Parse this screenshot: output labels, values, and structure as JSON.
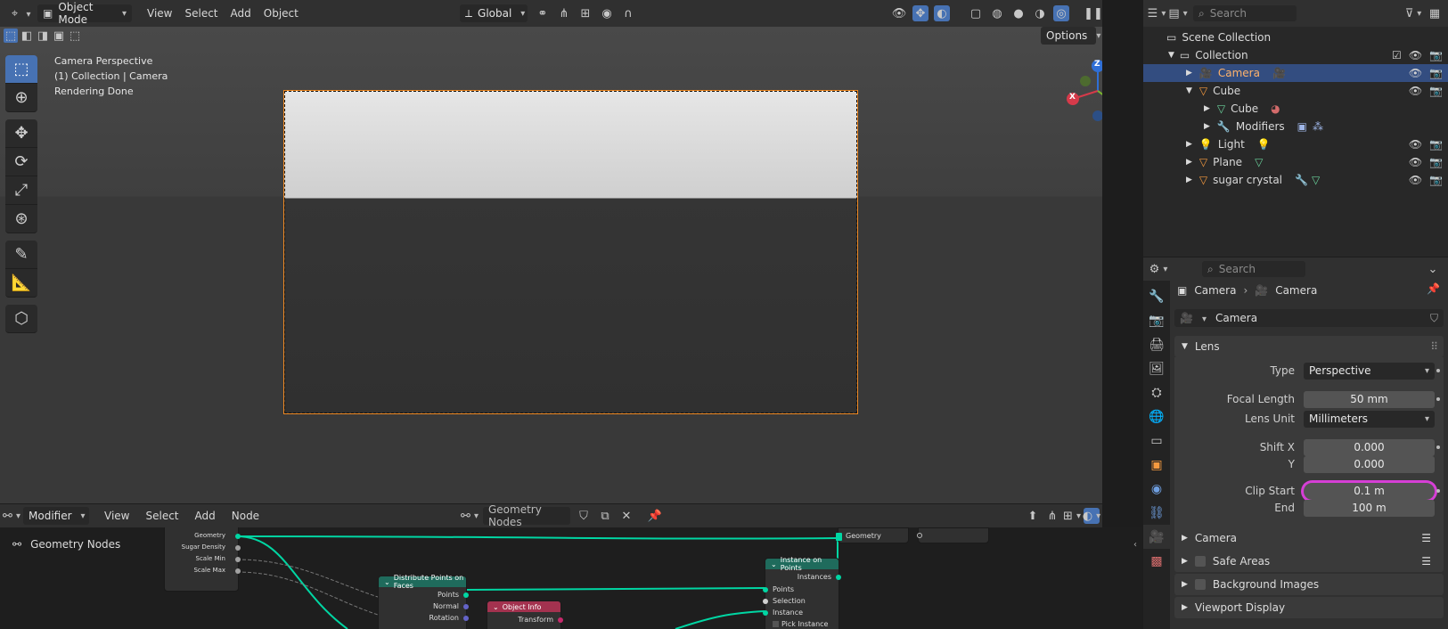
{
  "topbar": {
    "mode": "Object Mode",
    "menus": [
      "View",
      "Select",
      "Add",
      "Object"
    ],
    "transform_orientation": "Global"
  },
  "viewport": {
    "overlay_lines": [
      "Camera Perspective",
      "(1) Collection | Camera",
      "Rendering Done"
    ],
    "options_label": "Options",
    "gizmo_axes": [
      "Z",
      "X",
      "Y"
    ]
  },
  "outliner": {
    "search_placeholder": "Search",
    "items": [
      {
        "label": "Scene Collection"
      },
      {
        "label": "Collection"
      },
      {
        "label": "Camera"
      },
      {
        "label": "Cube"
      },
      {
        "label": "Cube"
      },
      {
        "label": "Modifiers"
      },
      {
        "label": "Light"
      },
      {
        "label": "Plane"
      },
      {
        "label": "sugar crystal"
      }
    ]
  },
  "properties": {
    "search_placeholder": "Search",
    "breadcrumb": [
      "Camera",
      "Camera"
    ],
    "datablock": "Camera",
    "lens_panel": "Lens",
    "fields": {
      "type_label": "Type",
      "type_value": "Perspective",
      "focal_label": "Focal Length",
      "focal_value": "50 mm",
      "unit_label": "Lens Unit",
      "unit_value": "Millimeters",
      "shiftx_label": "Shift X",
      "shiftx_value": "0.000",
      "shifty_label": "Y",
      "shifty_value": "0.000",
      "clipstart_label": "Clip Start",
      "clipstart_value": "0.1 m",
      "clipend_label": "End",
      "clipend_value": "100 m"
    },
    "panels": [
      "Camera",
      "Safe Areas",
      "Background Images",
      "Viewport Display"
    ]
  },
  "node_editor": {
    "editor_type": "Modifier",
    "menus": [
      "View",
      "Select",
      "Add",
      "Node"
    ],
    "tree_name": "Geometry Nodes",
    "side_label": "Geometry Nodes",
    "group_input_sockets": [
      "Geometry",
      "Sugar Density",
      "Scale Min",
      "Scale Max"
    ],
    "distribute_title": "Distribute Points on Faces",
    "distribute_outputs": [
      "Points",
      "Normal",
      "Rotation"
    ],
    "objinfo_title": "Object Info",
    "objinfo_outputs": [
      "Transform"
    ],
    "instance_title": "Instance on Points",
    "instance_output": "Instances",
    "instance_inputs": [
      "Points",
      "Selection",
      "Instance",
      "Pick Instance"
    ],
    "output_socket": "Geometry"
  },
  "colors": {
    "accent": "#4772b3",
    "selected_row": "#334d80",
    "highlight_ring": "#d63fd6",
    "geometry_link": "#00d6a3"
  }
}
